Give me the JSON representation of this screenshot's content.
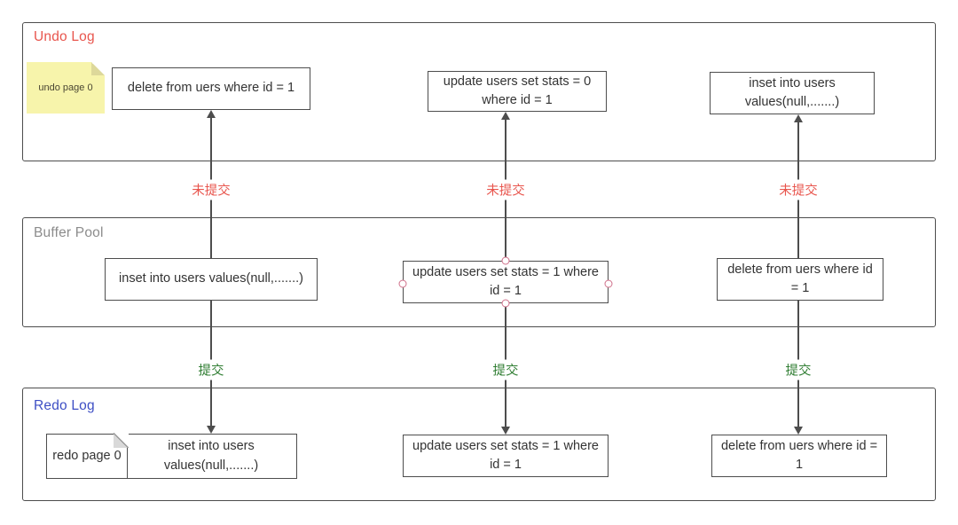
{
  "diagram": {
    "title": "MySQL undo log / buffer pool / redo log flow",
    "colors": {
      "undo_label": "#e8554d",
      "buffer_label": "#8c8c8c",
      "redo_label": "#3d4ec4",
      "uncommitted_label": "#e8554d",
      "committed_label": "#2f7d32",
      "stroke": "#4d4d4d",
      "sticky_note": "#f7f4ab",
      "handle_stroke": "#d0708a"
    }
  },
  "sections": {
    "undo": {
      "label": "Undo Log",
      "note": {
        "text": "undo page 0"
      },
      "boxes": [
        {
          "text": "delete from uers where id = 1"
        },
        {
          "text": "update users set stats = 0 where id = 1"
        },
        {
          "text": "inset into users values(null,.......)"
        }
      ]
    },
    "buffer": {
      "label": "Buffer Pool",
      "boxes": [
        {
          "text": "inset into users values(null,.......)",
          "selected": false
        },
        {
          "text": "update users set stats = 1 where id = 1",
          "selected": true
        },
        {
          "text": "delete from uers where id = 1",
          "selected": false
        }
      ]
    },
    "redo": {
      "label": "Redo Log",
      "note": {
        "text": "redo page 0"
      },
      "boxes": [
        {
          "text": "inset into users values(null,.......)"
        },
        {
          "text": "update users set stats = 1 where id = 1"
        },
        {
          "text": "delete from uers where id = 1"
        }
      ]
    }
  },
  "connectors": {
    "upward": [
      {
        "label": "未提交"
      },
      {
        "label": "未提交"
      },
      {
        "label": "未提交"
      }
    ],
    "downward": [
      {
        "label": "提交"
      },
      {
        "label": "提交"
      },
      {
        "label": "提交"
      }
    ]
  }
}
